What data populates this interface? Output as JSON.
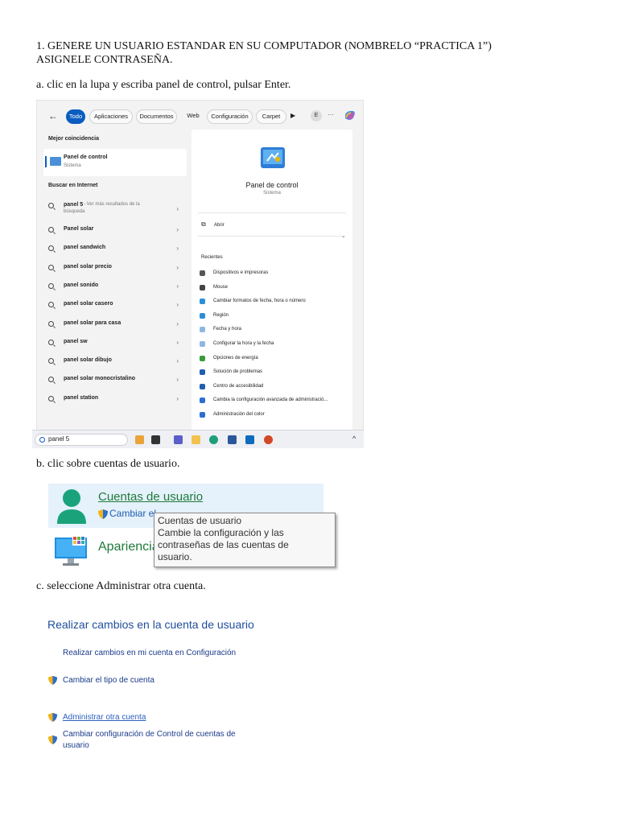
{
  "document": {
    "step1_line1": "1.   GENERE UN USUARIO ESTANDAR EN SU COMPUTADOR (NOMBRELO “PRACTICA  1”)",
    "step1_line2": "ASIGNELE CONTRASEÑA.",
    "step_a": "a.  clic en la lupa y escriba panel de control, pulsar Enter.",
    "step_b": "b. clic sobre cuentas de usuario.",
    "step_c": "c. seleccione Administrar otra cuenta."
  },
  "search": {
    "tabs": [
      "Todo",
      "Aplicaciones",
      "Documentos",
      "Web",
      "Configuración",
      "Carpet"
    ],
    "play_symbol": "▶",
    "avatar_letter": "E",
    "more_symbol": "···",
    "best_match_title": "Mejor coincidencia",
    "best_match_name": "Panel de control",
    "best_match_sub": "Sistema",
    "web_title": "Buscar en Internet",
    "first_suggestion": "panel 5",
    "first_suggestion_extra": " - Ver más resultados de la",
    "first_suggestion_extra2": "búsqueda",
    "suggestions": [
      "Panel solar",
      "panel sandwich",
      "panel solar precio",
      "panel sonido",
      "panel solar casero",
      "panel solar para casa",
      "panel sw",
      "panel solar dibujo",
      "panel solar monocristalino",
      "panel station"
    ],
    "detail_name": "Panel de control",
    "detail_sub": "Sistema",
    "open_label": "Abrir",
    "recent_title": "Recientes",
    "recent_items": [
      "Dispositivos e impresoras",
      "Mouse",
      "Cambiar formatos de fecha, hora o número",
      "Región",
      "Fecha y hora",
      "Configurar la hora y la fecha",
      "Opciones de energía",
      "Solución de problemas",
      "Centro de accesibilidad",
      "Cambia la configuración avanzada de administració...",
      "Administración del color"
    ],
    "taskbar_query": "panel 5",
    "taskbar_chevron": "^"
  },
  "control_panel": {
    "accounts_link": "Cuentas de usuario",
    "change_partial": "Cambiar el",
    "appearance_partial": "Apariencia",
    "tooltip_title": "Cuentas de usuario",
    "tooltip_line1": "Cambie la configuración y las",
    "tooltip_line2": "contraseñas de las cuentas de",
    "tooltip_line3": "usuario."
  },
  "accounts": {
    "heading": "Realizar cambios en la cuenta de usuario",
    "settings_link": "Realizar cambios en mi cuenta en Configuración",
    "change_type": "Cambiar el tipo de cuenta",
    "manage_other": "Administrar otra cuenta",
    "uac_line1": "Cambiar configuración de Control de cuentas de",
    "uac_line2": "usuario"
  },
  "colors": {
    "accent": "#0b5cc1",
    "link_green": "#1f7a3a",
    "heading_blue": "#1f4e9b",
    "highlight": "#e5f1fb"
  }
}
